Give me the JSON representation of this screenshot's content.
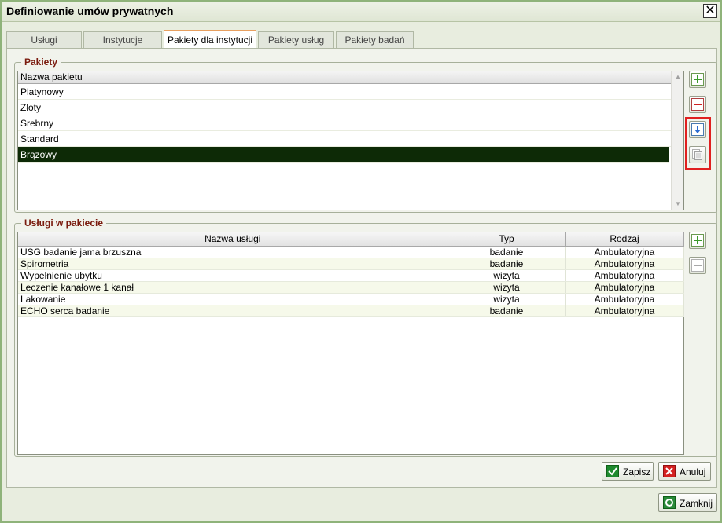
{
  "window": {
    "title": "Definiowanie umów prywatnych"
  },
  "tabs": [
    {
      "label": "Usługi"
    },
    {
      "label": "Instytucje"
    },
    {
      "label": "Pakiety dla instytucji"
    },
    {
      "label": "Pakiety usług"
    },
    {
      "label": "Pakiety badań"
    }
  ],
  "active_tab": "Pakiety dla instytucji",
  "packages": {
    "legend": "Pakiety",
    "column": "Nazwa pakietu",
    "items": [
      {
        "name": "Platynowy"
      },
      {
        "name": "Złoty"
      },
      {
        "name": "Srebrny"
      },
      {
        "name": "Standard"
      },
      {
        "name": "Brązowy"
      }
    ],
    "selected": "Brązowy"
  },
  "services": {
    "legend": "Usługi w pakiecie",
    "columns": {
      "name": "Nazwa usługi",
      "type": "Typ",
      "kind": "Rodzaj"
    },
    "rows": [
      {
        "name": "USG badanie jama brzuszna",
        "type": "badanie",
        "kind": "Ambulatoryjna"
      },
      {
        "name": "Spirometria",
        "type": "badanie",
        "kind": "Ambulatoryjna"
      },
      {
        "name": "Wypełnienie ubytku",
        "type": "wizyta",
        "kind": "Ambulatoryjna"
      },
      {
        "name": "Leczenie kanałowe 1 kanał",
        "type": "wizyta",
        "kind": "Ambulatoryjna"
      },
      {
        "name": "Lakowanie",
        "type": "wizyta",
        "kind": "Ambulatoryjna"
      },
      {
        "name": "ECHO serca badanie",
        "type": "badanie",
        "kind": "Ambulatoryjna"
      }
    ]
  },
  "buttons": {
    "save": "Zapisz",
    "cancel": "Anuluj",
    "close": "Zamknij"
  },
  "colors": {
    "selected_row": "#0d2a06",
    "legend": "#7a1b0e",
    "highlight": "#e02020"
  }
}
